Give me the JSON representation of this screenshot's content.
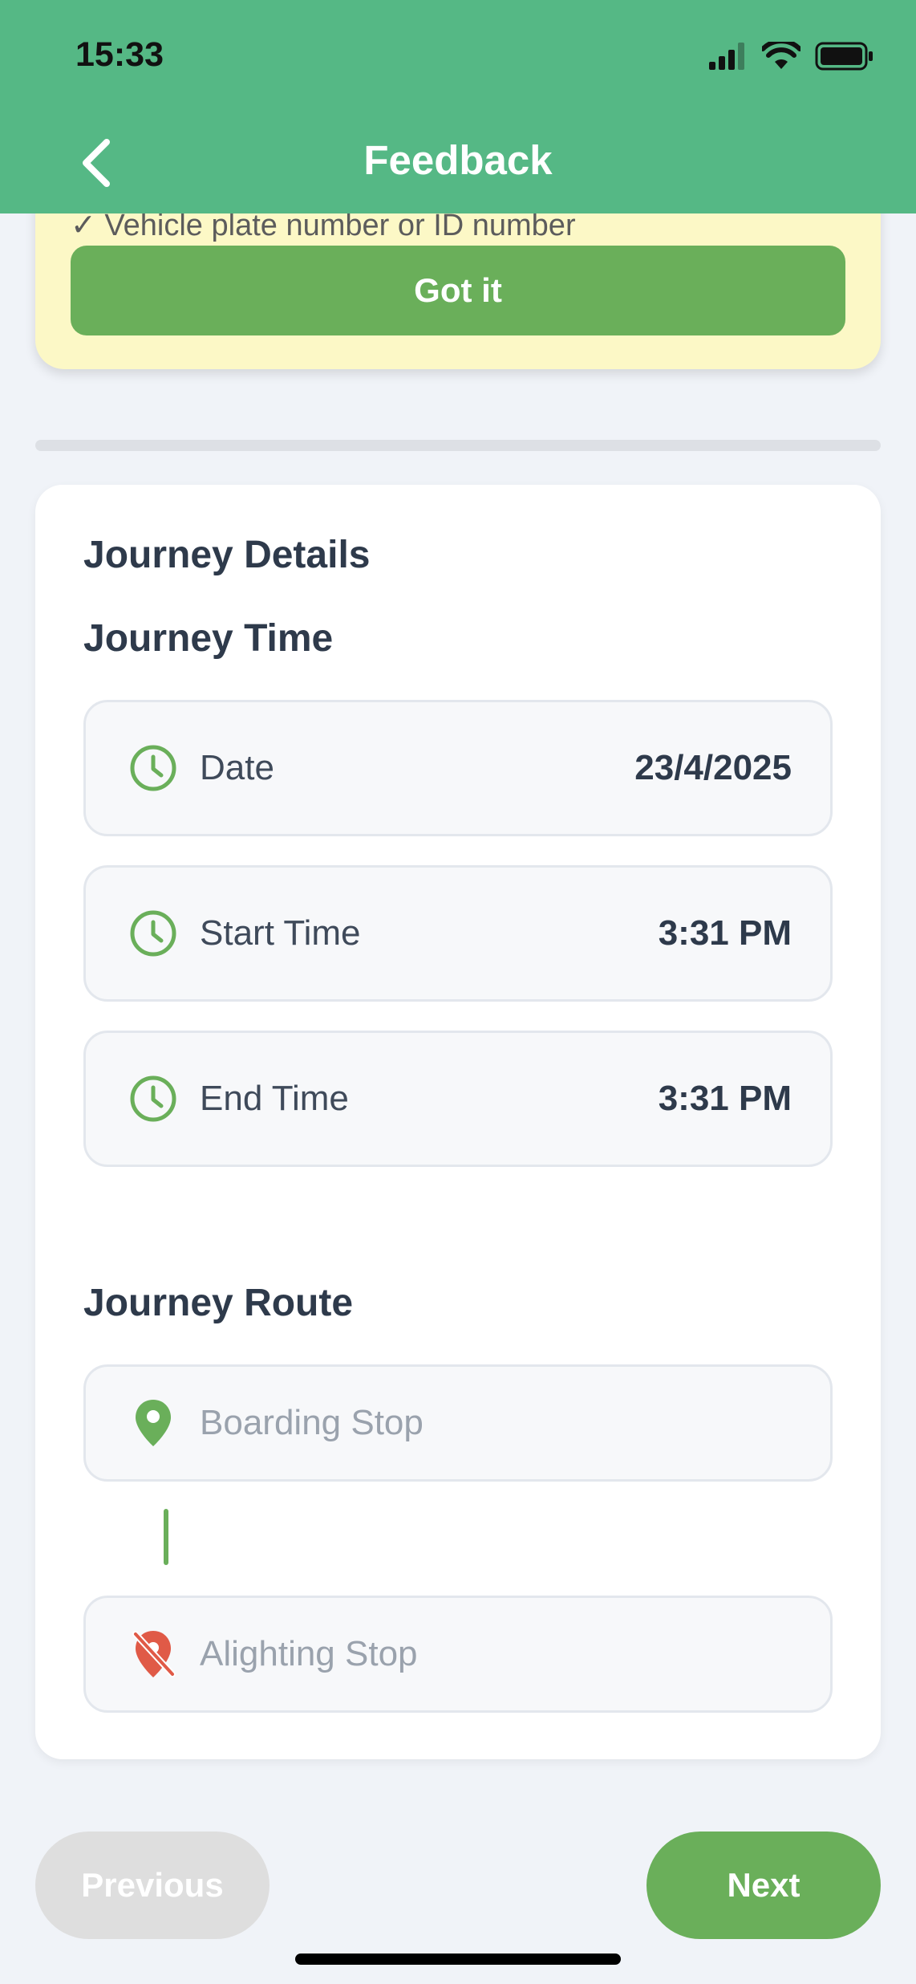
{
  "status_bar": {
    "time": "15:33"
  },
  "nav": {
    "title": "Feedback"
  },
  "tip": {
    "text": "✓ Vehicle plate number or ID number",
    "button": "Got it"
  },
  "journey": {
    "title": "Journey Details",
    "time_section": {
      "title": "Journey Time",
      "fields": [
        {
          "label": "Date",
          "value": "23/4/2025",
          "icon": "clock-icon"
        },
        {
          "label": "Start Time",
          "value": "3:31 PM",
          "icon": "clock-icon"
        },
        {
          "label": "End Time",
          "value": "3:31 PM",
          "icon": "clock-icon"
        }
      ]
    },
    "route_section": {
      "title": "Journey Route",
      "boarding_placeholder": "Boarding Stop",
      "alighting_placeholder": "Alighting Stop"
    }
  },
  "footer": {
    "previous": "Previous",
    "next": "Next"
  },
  "colors": {
    "header": "#55b885",
    "accent": "#6aaf5a",
    "alert_red": "#e05a47",
    "tip_bg": "#fcf8c6"
  }
}
